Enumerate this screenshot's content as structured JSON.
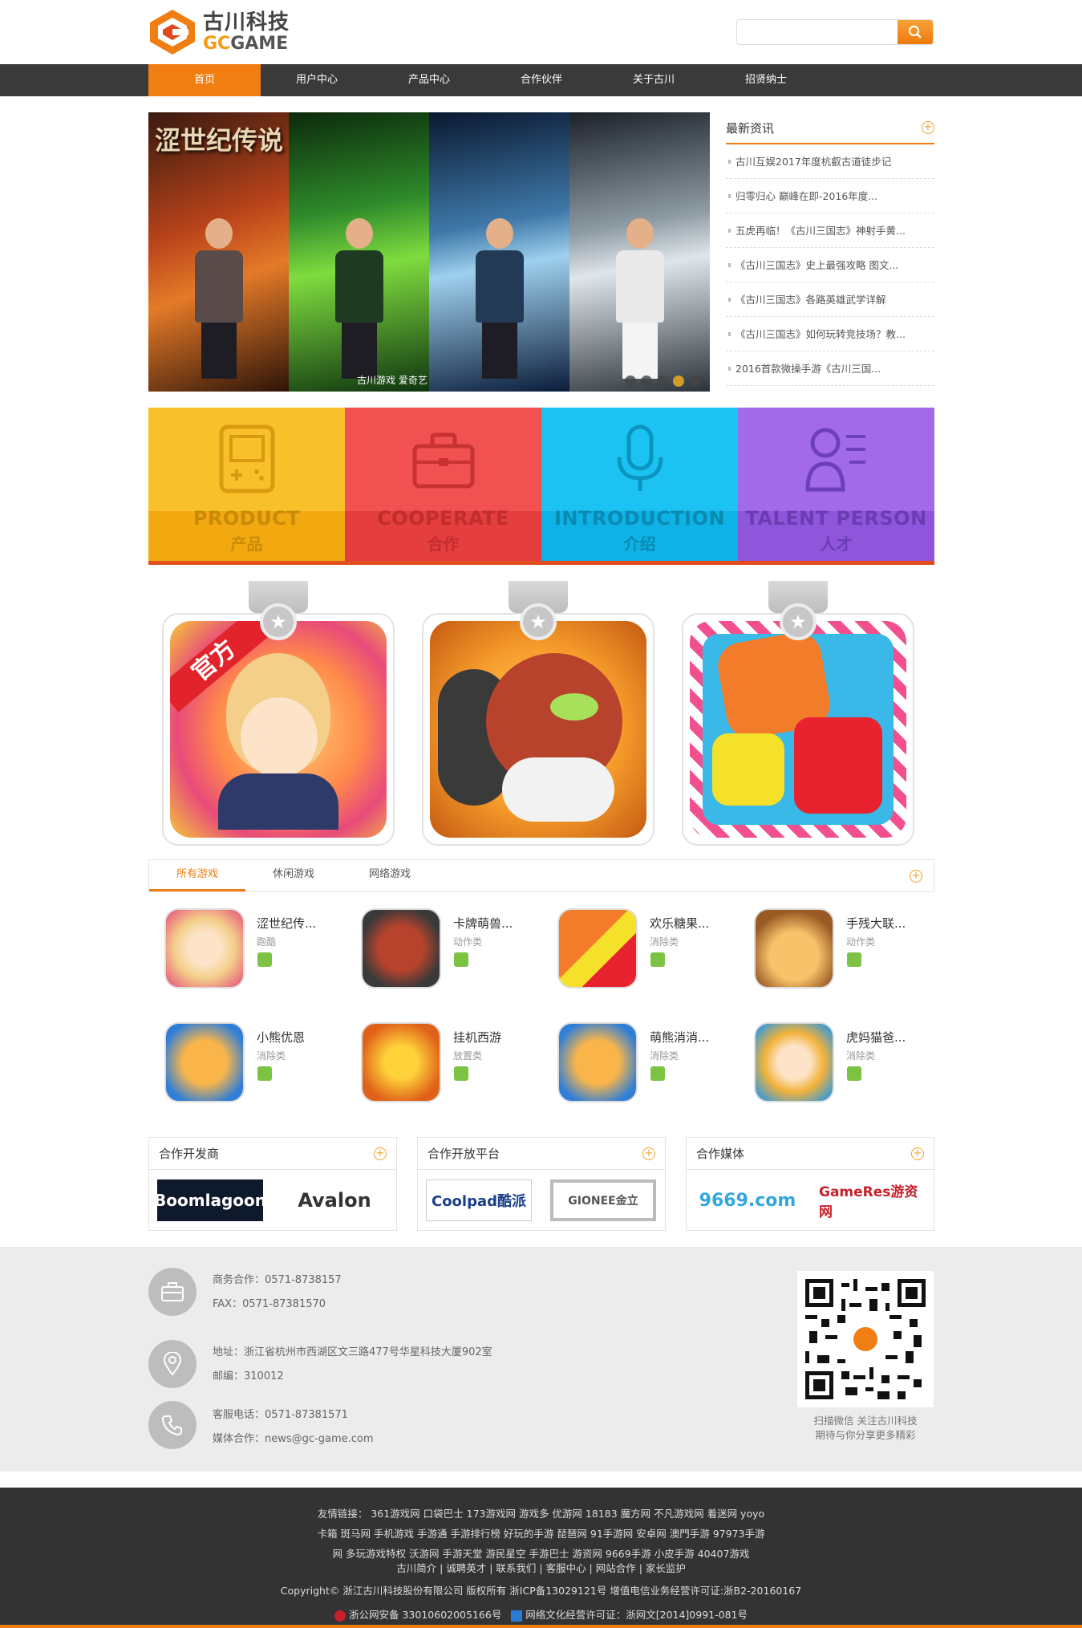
{
  "header": {
    "logo_cn": "古川科技",
    "logo_en_gc": "GC",
    "logo_en_game": "GAME",
    "search_placeholder": ""
  },
  "nav": [
    "首页",
    "用户中心",
    "产品中心",
    "合作伙伴",
    "关于古川",
    "招贤纳士"
  ],
  "banner": {
    "title": "涩世纪传说",
    "logos": "古川游戏  爱奇艺",
    "dots": 5,
    "active_dot": 4
  },
  "news": {
    "title": "最新资讯",
    "items": [
      "古川互娱2017年度杭叡古道徒步记",
      "归零归心 巅峰在即-2016年度...",
      "五虎再临！《古川三国志》神射手黄...",
      "《古川三国志》史上最强攻略 图文...",
      "《古川三国志》各路英雄武学详解",
      "《古川三国志》如何玩转竞技场？教...",
      "2016首款微操手游《古川三国..."
    ]
  },
  "tiles": [
    {
      "en": "PRODUCT",
      "cn": "产品"
    },
    {
      "en": "COOPERATE",
      "cn": "合作"
    },
    {
      "en": "INTRODUCTION",
      "cn": "介绍"
    },
    {
      "en": "TALENT PERSON",
      "cn": "人才"
    }
  ],
  "featured_badge": "官方",
  "game_tabs": [
    "所有游戏",
    "休闲游戏",
    "网络游戏"
  ],
  "games": [
    {
      "name": "涩世纪传...",
      "cat": "跑酷"
    },
    {
      "name": "卡牌萌兽...",
      "cat": "动作类"
    },
    {
      "name": "欢乐糖果...",
      "cat": "消除类"
    },
    {
      "name": "手残大联...",
      "cat": "动作类"
    },
    {
      "name": "小熊优恩",
      "cat": "消除类"
    },
    {
      "name": "挂机西游",
      "cat": "放置类"
    },
    {
      "name": "萌熊消消...",
      "cat": "消除类"
    },
    {
      "name": "虎妈猫爸...",
      "cat": "消除类"
    }
  ],
  "partners": [
    {
      "title": "合作开发商",
      "logos": [
        "Boomlagoon",
        "Avalon"
      ]
    },
    {
      "title": "合作开放平台",
      "logos": [
        "Coolpad酷派",
        "GIONEE金立"
      ]
    },
    {
      "title": "合作媒体",
      "logos": [
        "9669.com",
        "GameRes游资网"
      ]
    }
  ],
  "contact": {
    "biz": "商务合作：0571-8738157",
    "fax": "FAX：0571-87381570",
    "addr": "地址：浙江省杭州市西湖区文三路477号华星科技大厦902室",
    "zip": "邮编：310012",
    "service": "客服电话：0571-87381571",
    "media": "媒体合作：news@gc-game.com",
    "qr_caption_1": "扫描微信 关注古川科技",
    "qr_caption_2": "期待与你分享更多精彩"
  },
  "footer": {
    "links_1": "友情链接： 361游戏网   口袋巴士   173游戏网   游戏多   优游网   18183   魔方网   不凡游戏网   着迷网   yoyo",
    "links_2": "卡箱   斑马网   手机游戏   手游通   手游排行榜   好玩的手游   琵琶网   91手游网   安卓网   澳門手游   97973手游",
    "links_3": "网   多玩游戏特权   沃游网   手游天堂   游民星空   手游巴士   游资网   9669手游   小皮手游   40407游戏",
    "links_4": "古川简介 | 诚聘英才 | 联系我们 | 客服中心 | 网站合作 | 家长监护",
    "copyright": "Copyright© 浙江古川科技股份有限公司 版权所有 浙ICP备13029121号   增值电信业务经营许可证:浙B2-20160167",
    "police": "浙公网安备 33010602005166号",
    "culture": "网络文化经营许可证：浙网文[2014]0991-081号"
  }
}
